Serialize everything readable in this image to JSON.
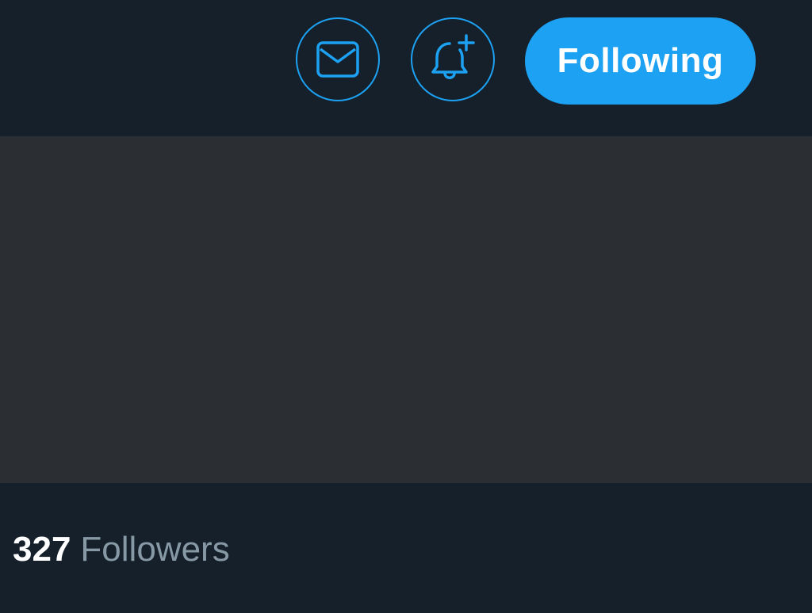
{
  "header": {
    "message_icon": "envelope-icon",
    "notify_icon": "bell-plus-icon",
    "follow_label": "Following"
  },
  "stats": {
    "followers_count": "327",
    "followers_label": "Followers"
  },
  "colors": {
    "background": "#15202b",
    "panel": "#2b2f34",
    "accent": "#1da1f2",
    "text_primary": "#ffffff",
    "text_secondary": "#8899a6"
  }
}
